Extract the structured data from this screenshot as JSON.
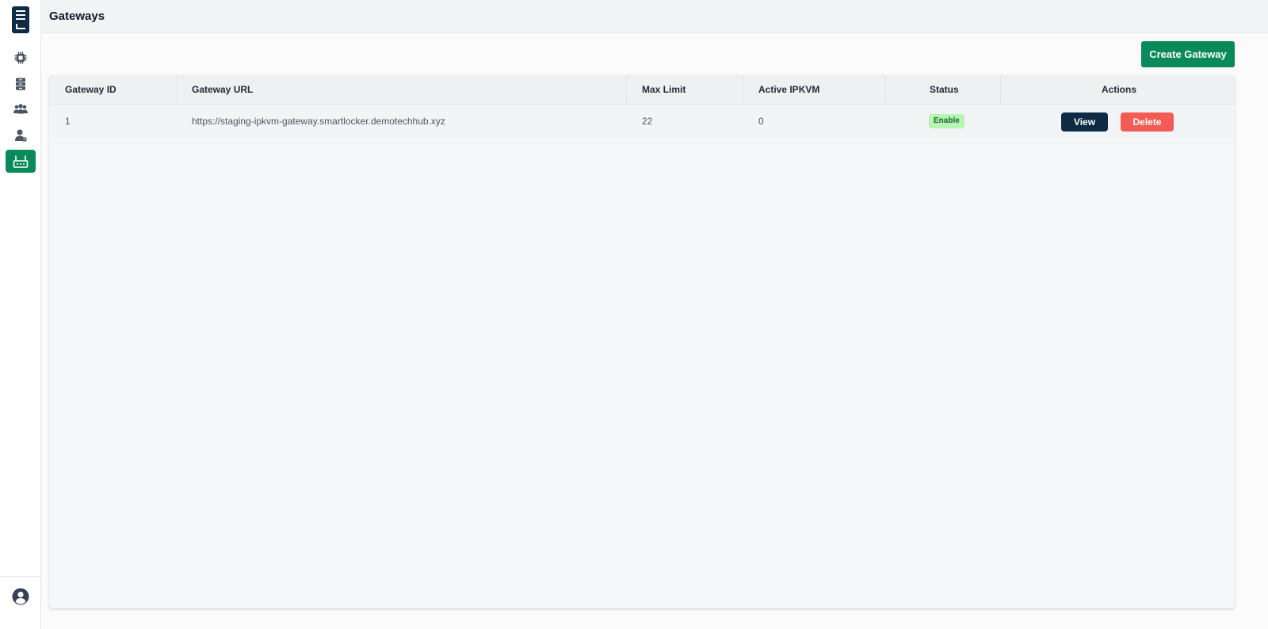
{
  "header": {
    "title": "Gateways"
  },
  "sidebar": {
    "items": [
      {
        "icon": "chip-icon",
        "active": false
      },
      {
        "icon": "server-icon",
        "active": false
      },
      {
        "icon": "users-icon",
        "active": false
      },
      {
        "icon": "user-badge-icon",
        "active": false
      },
      {
        "icon": "gateway-router-icon",
        "active": true
      }
    ],
    "user_icon": "user-circle-icon"
  },
  "toolbar": {
    "create_label": "Create Gateway"
  },
  "table": {
    "columns": [
      "Gateway ID",
      "Gateway URL",
      "Max Limit",
      "Active IPKVM",
      "Status",
      "Actions"
    ],
    "rows": [
      {
        "id": "1",
        "url": "https://staging-ipkvm-gateway.smartlocker.demotechhub.xyz",
        "max_limit": "22",
        "active_ipkvm": "0",
        "status": "Enable",
        "view_label": "View",
        "delete_label": "Delete"
      }
    ]
  },
  "colors": {
    "brand_dark": "#0f2a44",
    "accent_green": "#0a8a5a",
    "danger": "#f25c54",
    "status_enabled_bg": "#b7f5b3"
  }
}
